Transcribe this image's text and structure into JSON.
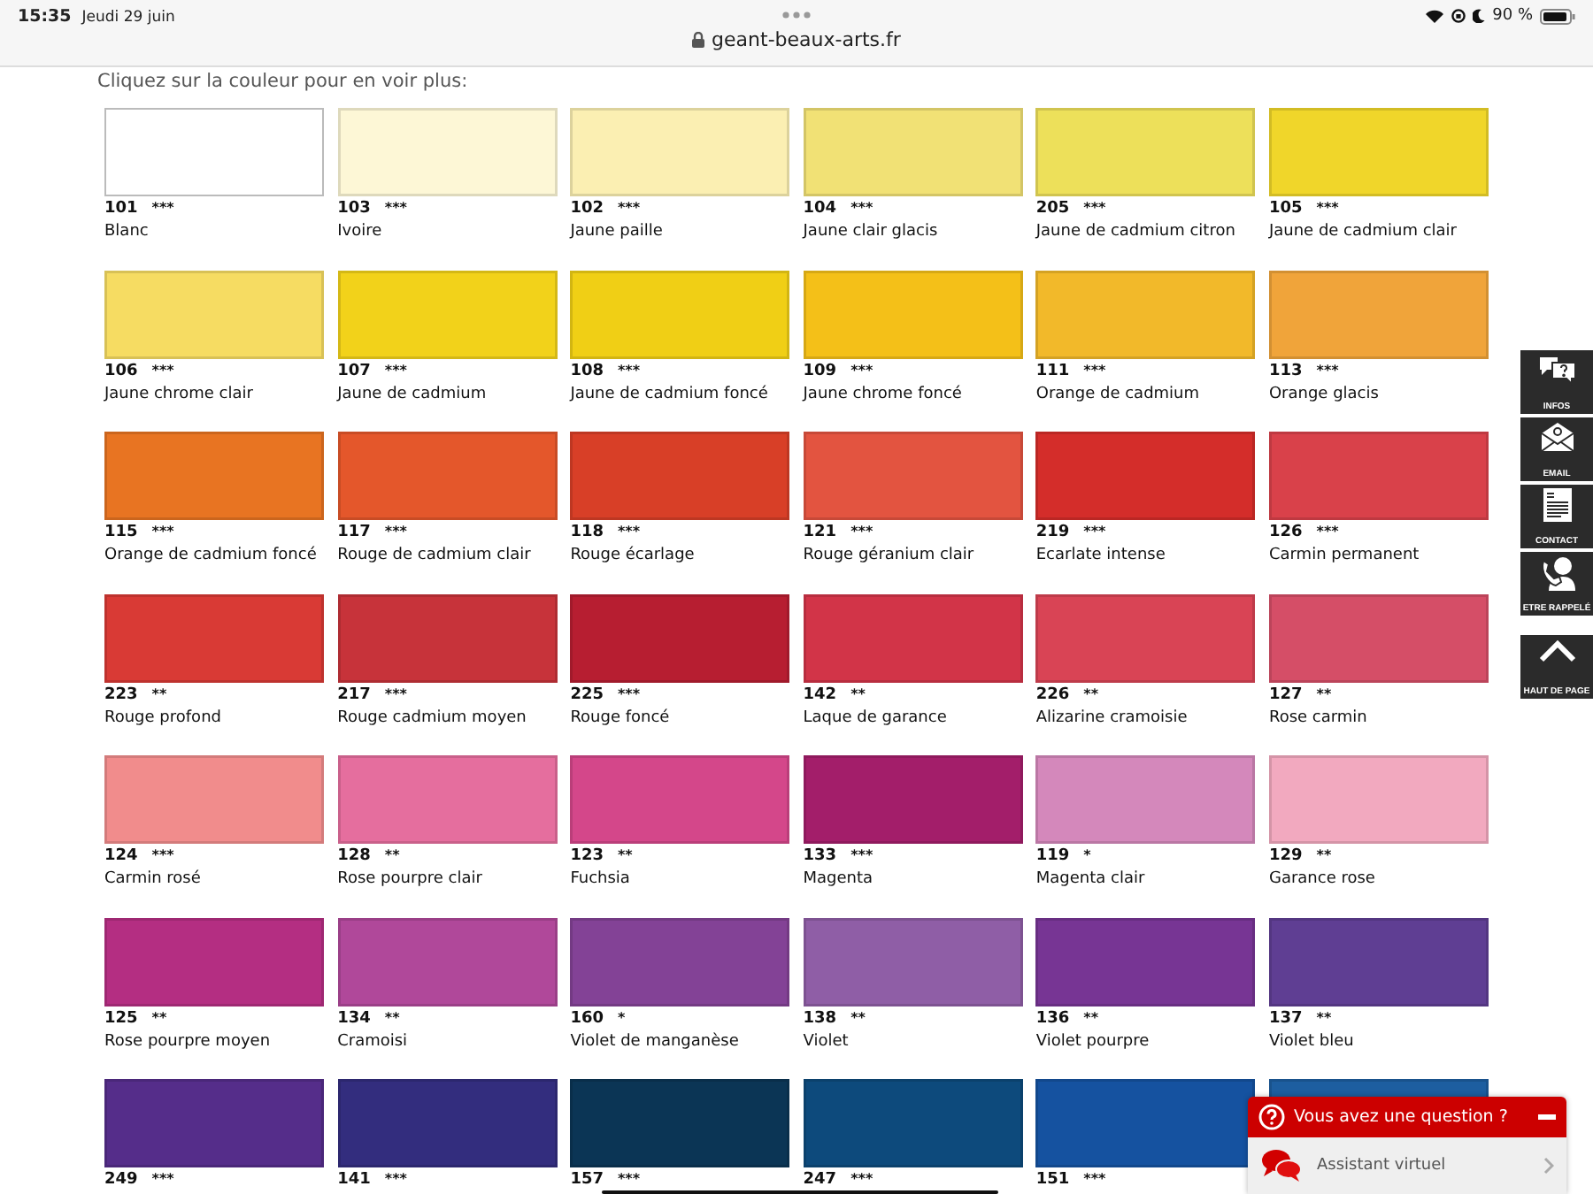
{
  "status_bar": {
    "time": "15:35",
    "date": "Jeudi 29 juin",
    "url": "geant-beaux-arts.fr",
    "battery": "90 %"
  },
  "instruction": "Cliquez sur la couleur pour en voir plus:",
  "swatches": [
    {
      "code": "101",
      "rating": "***",
      "name": "Blanc",
      "color": "#ffffff"
    },
    {
      "code": "103",
      "rating": "***",
      "name": "Ivoire",
      "color": "#fdf7d6"
    },
    {
      "code": "102",
      "rating": "***",
      "name": "Jaune paille",
      "color": "#fbefb2"
    },
    {
      "code": "104",
      "rating": "***",
      "name": "Jaune clair glacis",
      "color": "#f1e175"
    },
    {
      "code": "205",
      "rating": "***",
      "name": "Jaune de cadmium citron",
      "color": "#ede05a"
    },
    {
      "code": "105",
      "rating": "***",
      "name": "Jaune de cadmium clair",
      "color": "#f0d62a"
    },
    {
      "code": "106",
      "rating": "***",
      "name": "Jaune chrome clair",
      "color": "#f6dc62"
    },
    {
      "code": "107",
      "rating": "***",
      "name": "Jaune de cadmium",
      "color": "#f2d21a"
    },
    {
      "code": "108",
      "rating": "***",
      "name": "Jaune de cadmium foncé",
      "color": "#f0cf15"
    },
    {
      "code": "109",
      "rating": "***",
      "name": "Jaune chrome foncé",
      "color": "#f4c018"
    },
    {
      "code": "111",
      "rating": "***",
      "name": "Orange de cadmium",
      "color": "#f2b92a"
    },
    {
      "code": "113",
      "rating": "***",
      "name": "Orange glacis",
      "color": "#f0a43a"
    },
    {
      "code": "115",
      "rating": "***",
      "name": "Orange de cadmium foncé",
      "color": "#e87422"
    },
    {
      "code": "117",
      "rating": "***",
      "name": "Rouge de cadmium clair",
      "color": "#e4572b"
    },
    {
      "code": "118",
      "rating": "***",
      "name": "Rouge écarlage",
      "color": "#d83f27"
    },
    {
      "code": "121",
      "rating": "***",
      "name": "Rouge géranium clair",
      "color": "#e35440"
    },
    {
      "code": "219",
      "rating": "***",
      "name": "Ecarlate intense",
      "color": "#d42d2a"
    },
    {
      "code": "126",
      "rating": "***",
      "name": "Carmin permanent",
      "color": "#d9414a"
    },
    {
      "code": "223",
      "rating": "**",
      "name": "Rouge profond",
      "color": "#d93a35"
    },
    {
      "code": "217",
      "rating": "***",
      "name": "Rouge cadmium moyen",
      "color": "#c7333a"
    },
    {
      "code": "225",
      "rating": "***",
      "name": "Rouge foncé",
      "color": "#b71e31"
    },
    {
      "code": "142",
      "rating": "**",
      "name": "Laque de garance",
      "color": "#d23448"
    },
    {
      "code": "226",
      "rating": "**",
      "name": "Alizarine cramoisie",
      "color": "#d94455"
    },
    {
      "code": "127",
      "rating": "**",
      "name": "Rose carmin",
      "color": "#d54e67"
    },
    {
      "code": "124",
      "rating": "***",
      "name": "Carmin rosé",
      "color": "#f18c8c"
    },
    {
      "code": "128",
      "rating": "**",
      "name": "Rose pourpre clair",
      "color": "#e56e9e"
    },
    {
      "code": "123",
      "rating": "**",
      "name": "Fuchsia",
      "color": "#d4478a"
    },
    {
      "code": "133",
      "rating": "***",
      "name": "Magenta",
      "color": "#a31e6a"
    },
    {
      "code": "119",
      "rating": "*",
      "name": "Magenta clair",
      "color": "#d488bb"
    },
    {
      "code": "129",
      "rating": "**",
      "name": "Garance rose",
      "color": "#f2a9bf"
    },
    {
      "code": "125",
      "rating": "**",
      "name": "Rose pourpre moyen",
      "color": "#b42e82"
    },
    {
      "code": "134",
      "rating": "**",
      "name": "Cramoisi",
      "color": "#b0489a"
    },
    {
      "code": "160",
      "rating": "*",
      "name": "Violet de manganèse",
      "color": "#834296"
    },
    {
      "code": "138",
      "rating": "**",
      "name": "Violet",
      "color": "#8f5ea6"
    },
    {
      "code": "136",
      "rating": "**",
      "name": "Violet pourpre",
      "color": "#773594"
    },
    {
      "code": "137",
      "rating": "**",
      "name": "Violet bleu",
      "color": "#5f3e93"
    },
    {
      "code": "249",
      "rating": "***",
      "color": "#552d8a"
    },
    {
      "code": "141",
      "rating": "***",
      "color": "#332d7e"
    },
    {
      "code": "157",
      "rating": "***",
      "color": "#0b3555"
    },
    {
      "code": "247",
      "rating": "***",
      "color": "#0d4a7c"
    },
    {
      "code": "151",
      "rating": "***",
      "color": "#1552a0"
    },
    {
      "color": "#1d5ea0"
    }
  ],
  "side_menu": [
    {
      "kind": "infos",
      "label": "INFOS"
    },
    {
      "kind": "email",
      "label": "EMAIL"
    },
    {
      "kind": "contact",
      "label": "CONTACT"
    },
    {
      "kind": "callback",
      "label": "ETRE RAPPELÉ"
    },
    {
      "kind": "top",
      "label": "HAUT DE PAGE"
    }
  ],
  "chat_widget": {
    "title": "Vous avez une question ?",
    "assistant": "Assistant virtuel"
  }
}
